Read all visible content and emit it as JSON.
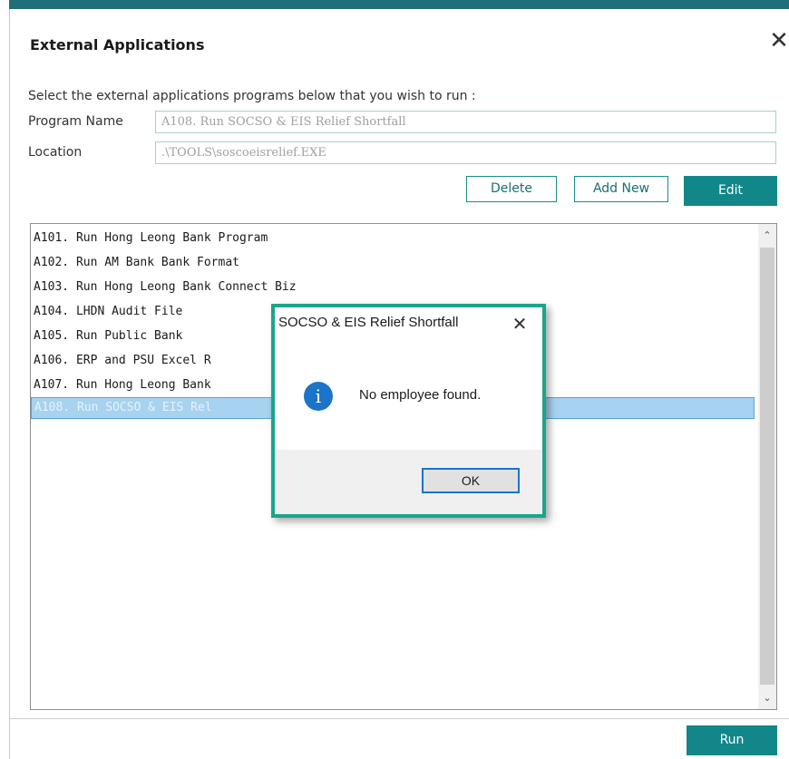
{
  "window": {
    "title": "External Applications",
    "instruction": "Select the external applications programs below that you wish to run :"
  },
  "fields": {
    "program_name_label": "Program Name",
    "program_name_value": "A108. Run SOCSO & EIS Relief Shortfall",
    "location_label": "Location",
    "location_value": ".\\TOOLS\\soscoeisrelief.EXE"
  },
  "toolbar": {
    "delete_label": "Delete",
    "add_new_label": "Add New",
    "edit_label": "Edit"
  },
  "list": {
    "items": [
      {
        "label": "A101. Run Hong Leong Bank Program"
      },
      {
        "label": "A102. Run AM Bank Bank Format"
      },
      {
        "label": "A103. Run Hong Leong Bank Connect Biz"
      },
      {
        "label": "A104. LHDN Audit File"
      },
      {
        "label": "A105. Run Public Bank"
      },
      {
        "label": "A106. ERP and PSU Excel R"
      },
      {
        "label": "A107. Run Hong Leong Bank"
      },
      {
        "label": "A108. Run SOCSO & EIS Rel",
        "selected": true
      }
    ]
  },
  "footer": {
    "run_label": "Run"
  },
  "dialog": {
    "title": "SOCSO & EIS Relief Shortfall",
    "message": "No employee found.",
    "ok_label": "OK",
    "icon": "info-icon"
  },
  "colors": {
    "accent": "#12878a",
    "dialog_border": "#1aa58c",
    "selection": "#a7d2f0",
    "info_blue": "#1b74c8"
  }
}
